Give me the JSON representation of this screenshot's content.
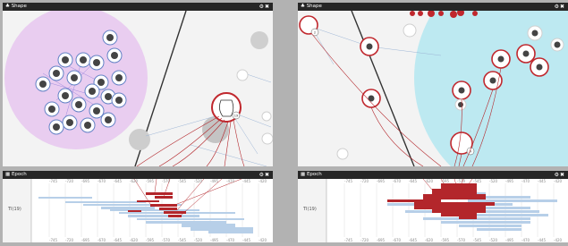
{
  "windows": {
    "left": {
      "shape_panel": {
        "icon": "shape-icon",
        "title": "Shape",
        "controls": "⚙✖"
      },
      "epoch_panel": {
        "icon": "calendar-icon",
        "title": "Epoch",
        "controls": "⚙✖",
        "row_label": "TI(19)",
        "ticks_top": [
          "-745",
          "-720",
          "-695",
          "-670",
          "-645",
          "-620",
          "-595",
          "-570",
          "-545",
          "-520",
          "-495",
          "-470",
          "-445",
          "-420"
        ],
        "ticks_bottom": [
          "-745",
          "-720",
          "-695",
          "-670",
          "-645",
          "-620",
          "-595",
          "-570",
          "-545",
          "-520",
          "-495",
          "-470",
          "-445",
          "-420"
        ],
        "badge": "19"
      }
    },
    "right": {
      "shape_panel": {
        "icon": "shape-icon",
        "title": "Shape",
        "controls": "⚙✖",
        "badge": "2",
        "badge2": "9"
      },
      "epoch_panel": {
        "icon": "calendar-icon",
        "title": "Epoch",
        "controls": "⚙✖",
        "row_label": "TI(19)",
        "ticks_top": [
          "-745",
          "-720",
          "-695",
          "-670",
          "-645",
          "-620",
          "-595",
          "-570",
          "-545",
          "-520",
          "-495",
          "-470",
          "-445",
          "-420"
        ],
        "ticks_bottom": [
          "-745",
          "-720",
          "-695",
          "-670",
          "-645",
          "-620",
          "-595",
          "-570",
          "-545",
          "-520",
          "-495",
          "-470",
          "-445",
          "-420"
        ]
      }
    }
  },
  "colors": {
    "accent_red": "#c0272d",
    "purple_region": "#e8c4ef",
    "cyan_region": "#bde9f1",
    "blue_bar": "#b7cfe8"
  }
}
